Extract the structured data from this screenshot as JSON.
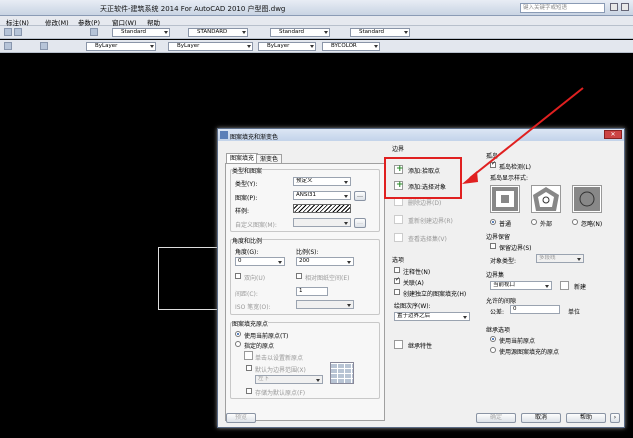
{
  "app": {
    "title": "天正软件-建筑系统 2014  For AutoCAD 2010      户型图.dwg",
    "search_placeholder": "键入关键字或短语"
  },
  "menubar": {
    "items": [
      "标注(N)",
      "修改(M)",
      "参数(P)",
      "窗口(W)",
      "帮助"
    ]
  },
  "toolbar": {
    "style1": "Standard",
    "style2": "STANDARD",
    "style3": "Standard",
    "style4": "Standard",
    "layer": "ByLayer",
    "linetype": "ByLayer",
    "lineweight": "ByLayer",
    "plotstyle": "BYCOLOR"
  },
  "dialog": {
    "title": "图案填充和渐变色",
    "tabs": [
      "图案填充",
      "渐变色"
    ],
    "type_pattern": {
      "group": "类型和图案",
      "type_label": "类型(Y):",
      "type_value": "预定义",
      "pattern_label": "图案(P):",
      "pattern_value": "ANSI31",
      "swatch_label": "样例:",
      "custom_label": "自定义图案(M):"
    },
    "angle_scale": {
      "group": "角度和比例",
      "angle_label": "角度(G):",
      "angle_value": "0",
      "scale_label": "比例(S):",
      "scale_value": "200",
      "double_label": "双向(U)",
      "relative_label": "相对图纸空间(E)",
      "spacing_label": "间距(C):",
      "spacing_value": "1",
      "iso_label": "ISO 笔宽(O):"
    },
    "origin": {
      "group": "图案填充原点",
      "use_current": "使用当前原点(T)",
      "specified": "指定的原点",
      "click_set": "单击以设置新原点",
      "default_extent": "默认为边界范围(X)",
      "position": "左下",
      "store_default": "存储为默认原点(F)"
    },
    "boundary": {
      "group": "边界",
      "add_pick": "添加:拾取点",
      "add_select": "添加:选择对象",
      "remove": "删除边界(D)",
      "recreate": "重新创建边界(R)",
      "view_sel": "查看选择集(V)"
    },
    "options": {
      "group": "选项",
      "annotative": "注释性(N)",
      "associative": "关联(A)",
      "separate": "创建独立的图案填充(H)",
      "draw_order_label": "绘图次序(W):",
      "draw_order_value": "置于边界之后",
      "inherit": "继承特性"
    },
    "islands": {
      "group": "孤岛",
      "detect": "孤岛检测(L)",
      "style_label": "孤岛显示样式:",
      "normal": "普通",
      "outer": "外部",
      "ignore": "忽略(N)"
    },
    "retain": {
      "group": "边界保留",
      "retain_label": "保留边界(S)",
      "object_type_label": "对象类型:",
      "object_type_value": "多段线"
    },
    "boundary_set": {
      "group": "边界集",
      "value": "当前视口",
      "new_label": "新建"
    },
    "gap": {
      "group": "允许的间隙",
      "tolerance_label": "公差:",
      "value": "0",
      "unit": "单位"
    },
    "inherit_opts": {
      "group": "继承选项",
      "current_origin": "使用当前原点",
      "source_origin": "使用源图案填充的原点"
    },
    "buttons": {
      "preview": "预览",
      "ok": "确定",
      "cancel": "取消",
      "help": "帮助"
    }
  },
  "colors": {
    "highlight": "#e02020",
    "arrow": "#e02020"
  }
}
